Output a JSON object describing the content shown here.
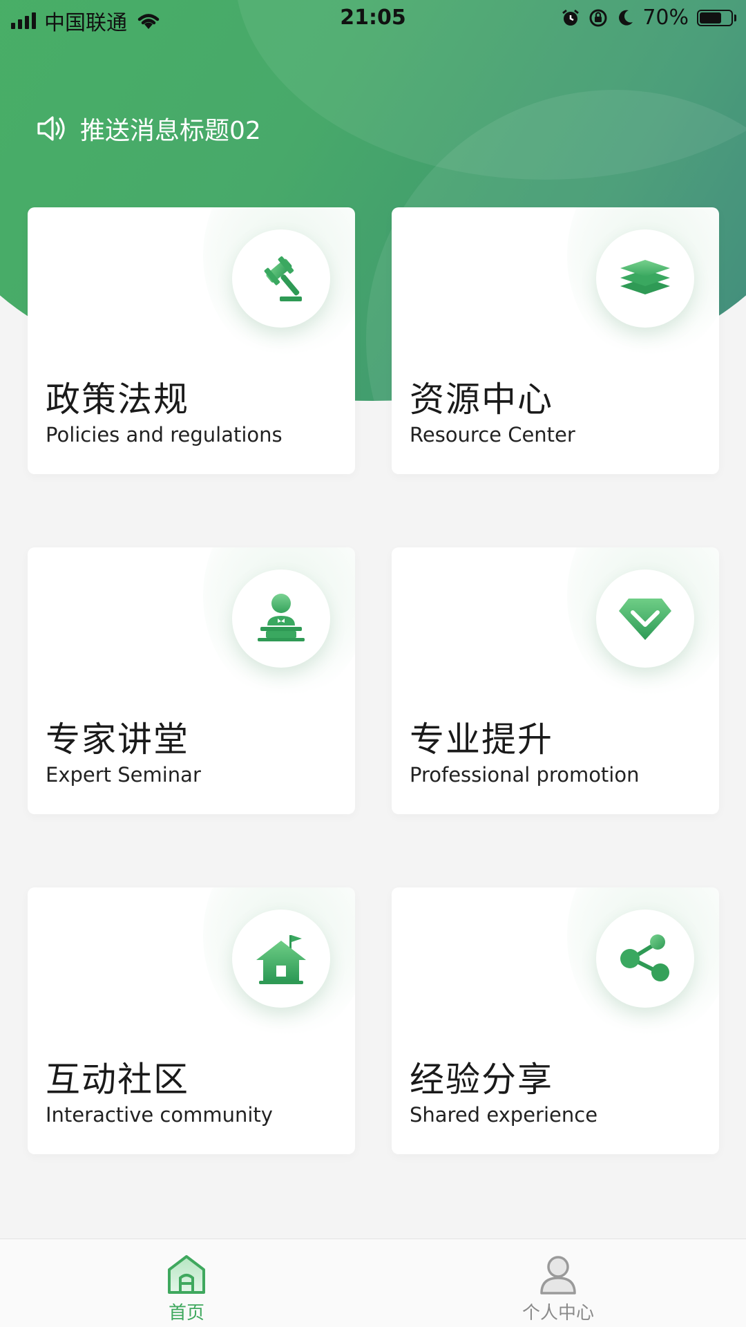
{
  "status_bar": {
    "carrier": "中国联通",
    "time": "21:05",
    "battery": "70%",
    "battery_level": 0.7
  },
  "notice": {
    "text": "推送消息标题02",
    "icon": "speaker-icon"
  },
  "cards": [
    {
      "title_zh": "政策法规",
      "title_en": "Policies and regulations",
      "icon": "gavel-icon"
    },
    {
      "title_zh": "资源中心",
      "title_en": "Resource Center",
      "icon": "layers-icon"
    },
    {
      "title_zh": "专家讲堂",
      "title_en": "Expert Seminar",
      "icon": "lecturer-icon"
    },
    {
      "title_zh": "专业提升",
      "title_en": "Professional promotion",
      "icon": "diamond-icon"
    },
    {
      "title_zh": "互动社区",
      "title_en": "Interactive community",
      "icon": "house-flag-icon"
    },
    {
      "title_zh": "经验分享",
      "title_en": "Shared experience",
      "icon": "share-icon"
    }
  ],
  "tabbar": {
    "tabs": [
      {
        "label": "首页",
        "icon": "home-icon",
        "active": true
      },
      {
        "label": "个人中心",
        "icon": "profile-icon",
        "active": false
      }
    ]
  },
  "colors": {
    "brand_green": "#3fa85e",
    "header_green": "#48a96a",
    "inactive_gray": "#9a9a9a",
    "background": "#f4f4f4"
  }
}
